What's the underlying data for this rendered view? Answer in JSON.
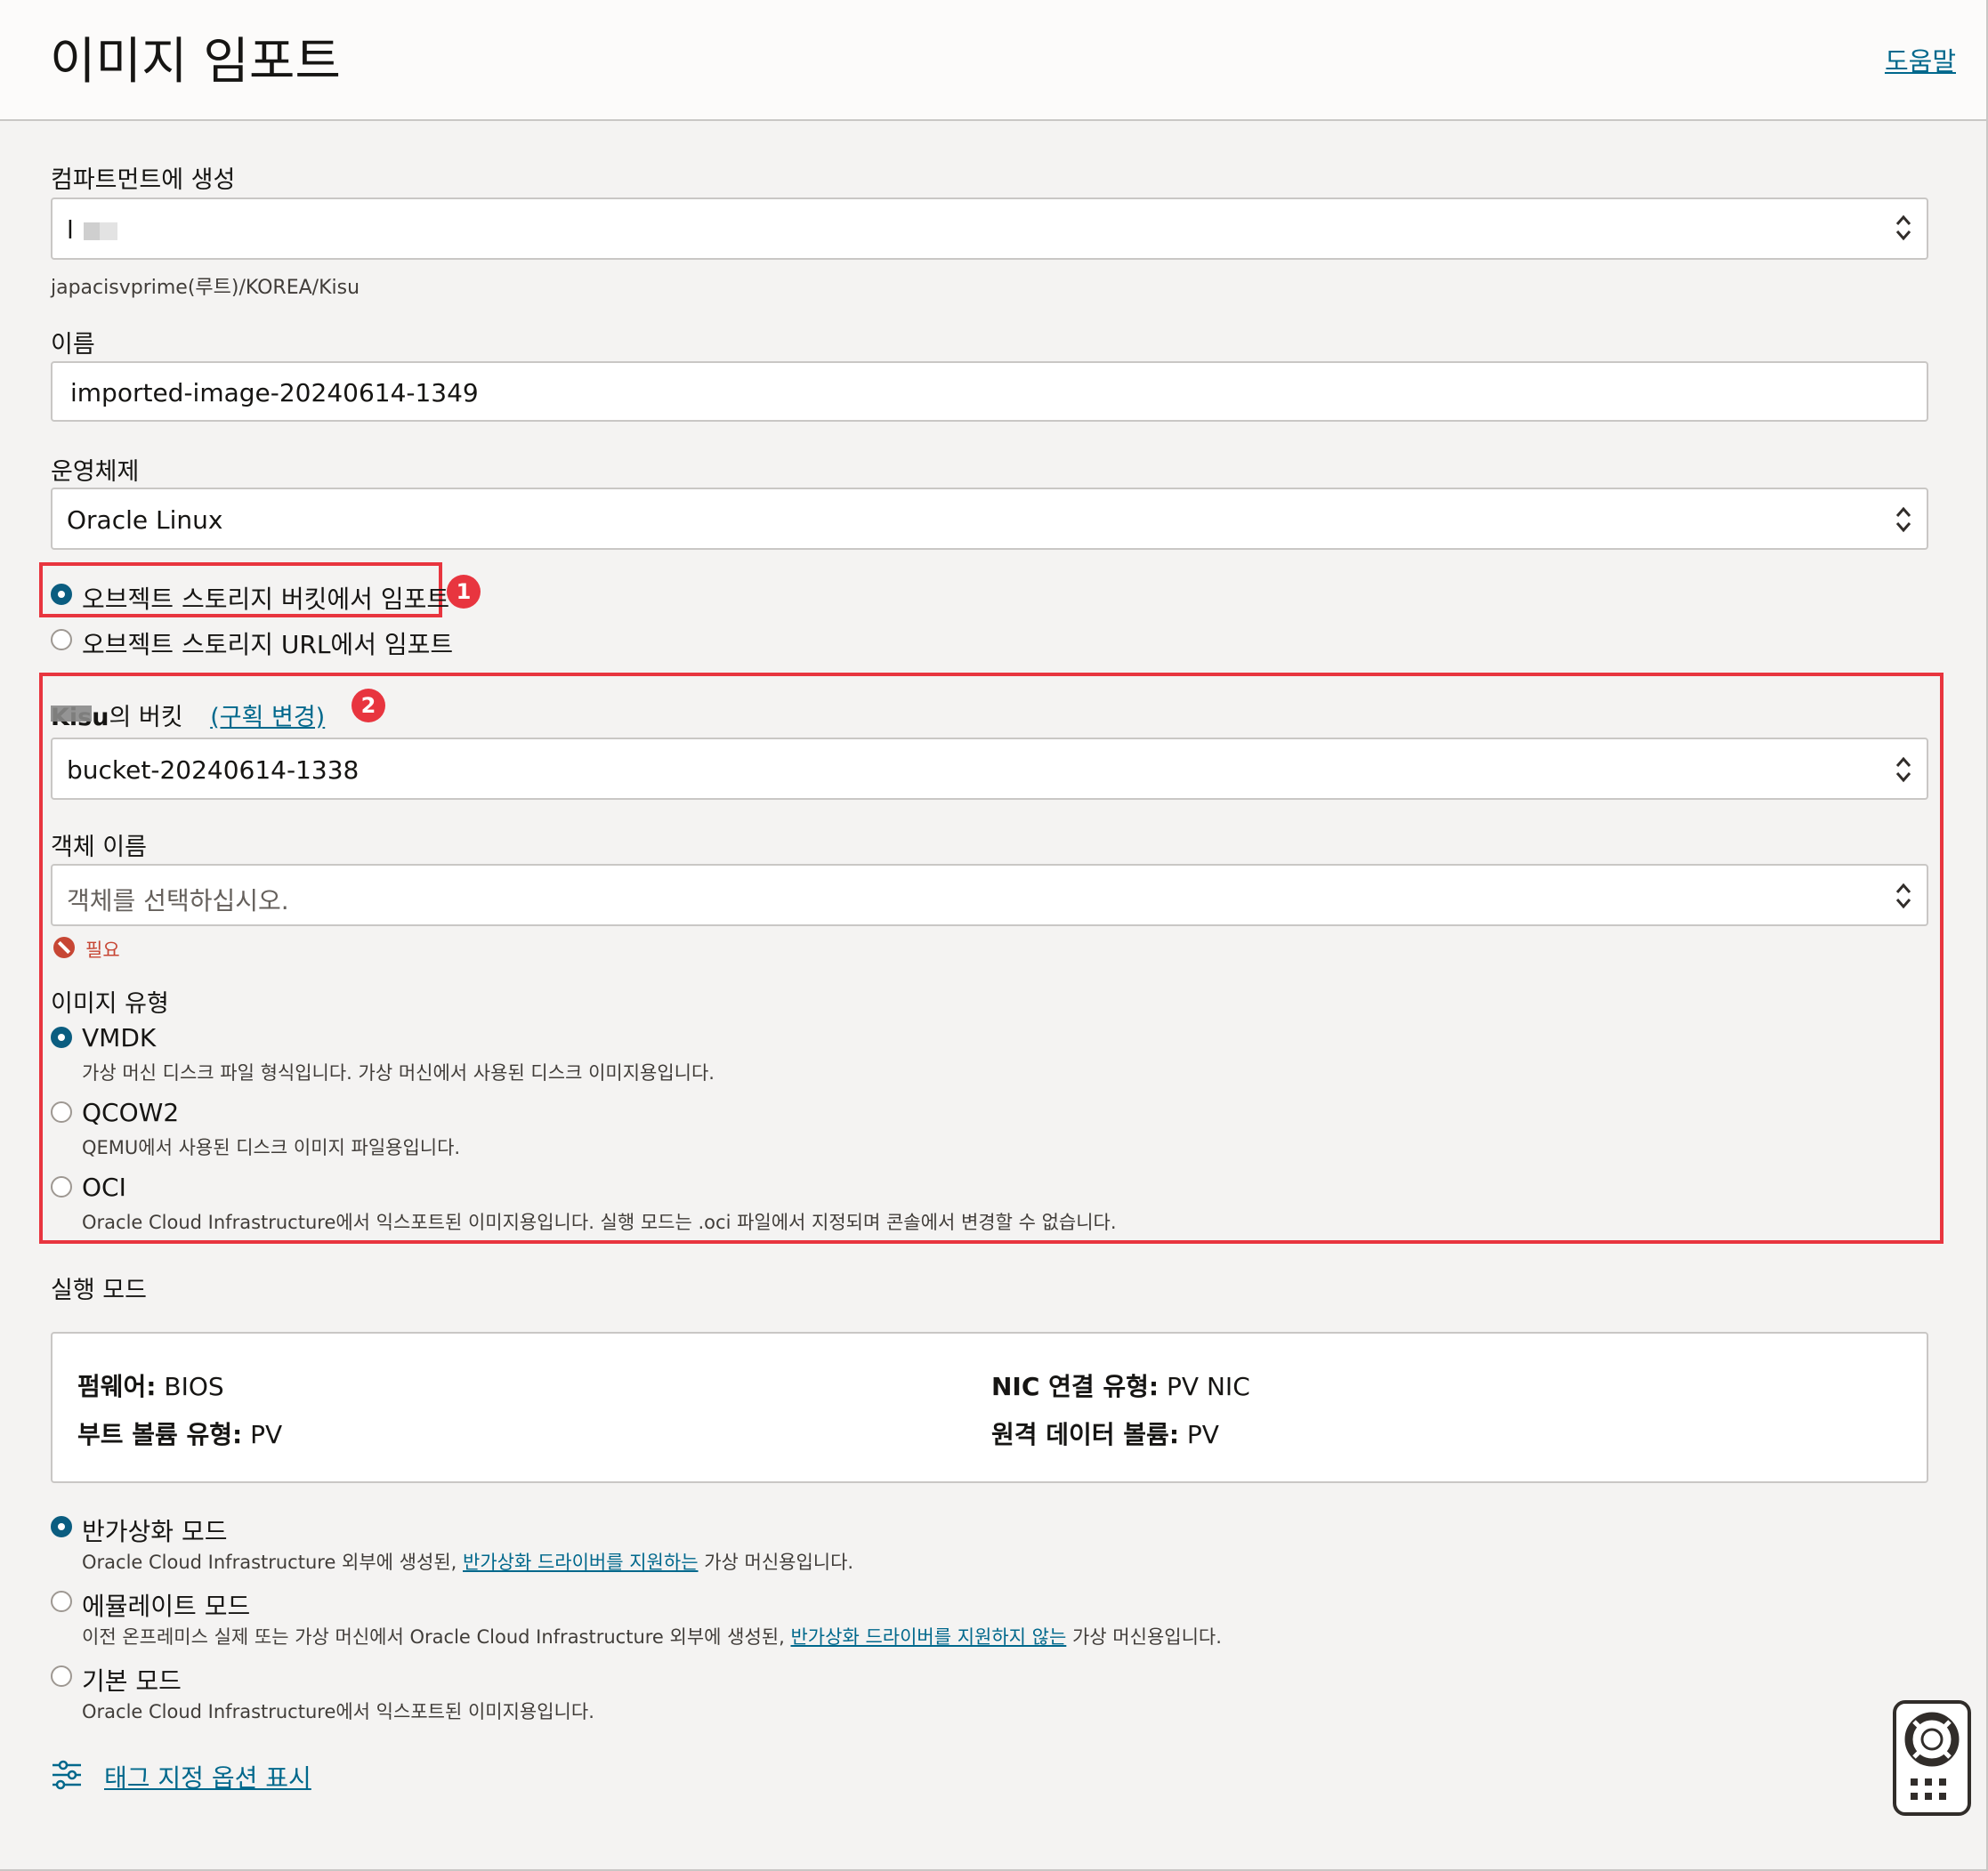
{
  "header": {
    "title": "이미지 임포트",
    "help_label": "도움말"
  },
  "compartment": {
    "label": "컴파트먼트에 생성",
    "value": "l",
    "path": "japacisvprime(루트)/KOREA/Kisu"
  },
  "name": {
    "label": "이름",
    "value": "imported-image-20240614-1349"
  },
  "os": {
    "label": "운영체제",
    "value": "Oracle Linux"
  },
  "source": {
    "options": [
      {
        "label": "오브젝트 스토리지 버킷에서 임포트",
        "selected": true
      },
      {
        "label": "오브젝트 스토리지 URL에서 임포트",
        "selected": false
      }
    ]
  },
  "bucket": {
    "label_prefix": "Kisu",
    "label_suffix": "의 버킷",
    "change_link": "(구획 변경)",
    "value": "bucket-20240614-1338"
  },
  "object": {
    "label": "객체 이름",
    "placeholder": "객체를 선택하십시오.",
    "error": "필요"
  },
  "image_type": {
    "label": "이미지 유형",
    "options": [
      {
        "label": "VMDK",
        "desc": "가상 머신 디스크 파일 형식입니다. 가상 머신에서 사용된 디스크 이미지용입니다.",
        "selected": true
      },
      {
        "label": "QCOW2",
        "desc": "QEMU에서 사용된 디스크 이미지 파일용입니다.",
        "selected": false
      },
      {
        "label": "OCI",
        "desc": "Oracle Cloud Infrastructure에서 익스포트된 이미지용입니다. 실행 모드는 .oci 파일에서 지정되며 콘솔에서 변경할 수 없습니다.",
        "selected": false
      }
    ]
  },
  "launch_mode": {
    "label": "실행 모드",
    "details": {
      "firmware_key": "펌웨어:",
      "firmware_val": "BIOS",
      "nic_key": "NIC 연결 유형:",
      "nic_val": "PV NIC",
      "boot_key": "부트 볼륨 유형:",
      "boot_val": "PV",
      "remote_key": "원격 데이터 볼륨:",
      "remote_val": "PV"
    },
    "options": [
      {
        "label": "반가상화 모드",
        "desc_pre": "Oracle Cloud Infrastructure 외부에 생성된, ",
        "desc_link": "반가상화 드라이버를 지원하는",
        "desc_post": " 가상 머신용입니다.",
        "selected": true
      },
      {
        "label": "에뮬레이트 모드",
        "desc_pre": "이전 온프레미스 실제 또는 가상 머신에서 Oracle Cloud Infrastructure 외부에 생성된, ",
        "desc_link": "반가상화 드라이버를 지원하지 않는",
        "desc_post": " 가상 머신용입니다.",
        "selected": false
      },
      {
        "label": "기본 모드",
        "desc_pre": "Oracle Cloud Infrastructure에서 익스포트된 이미지용입니다.",
        "desc_link": "",
        "desc_post": "",
        "selected": false
      }
    ]
  },
  "tags_link": "태그 지정 옵션 표시",
  "annotations": {
    "badge1": "1",
    "badge2": "2"
  },
  "colors": {
    "accent": "#0b5d80",
    "link": "#00688c",
    "highlight": "#e8353f",
    "error": "#c74634"
  },
  "icons": {
    "select": "updown-chevron-icon",
    "tags": "sliders-icon",
    "assistant": "lifebuoy-icon"
  }
}
